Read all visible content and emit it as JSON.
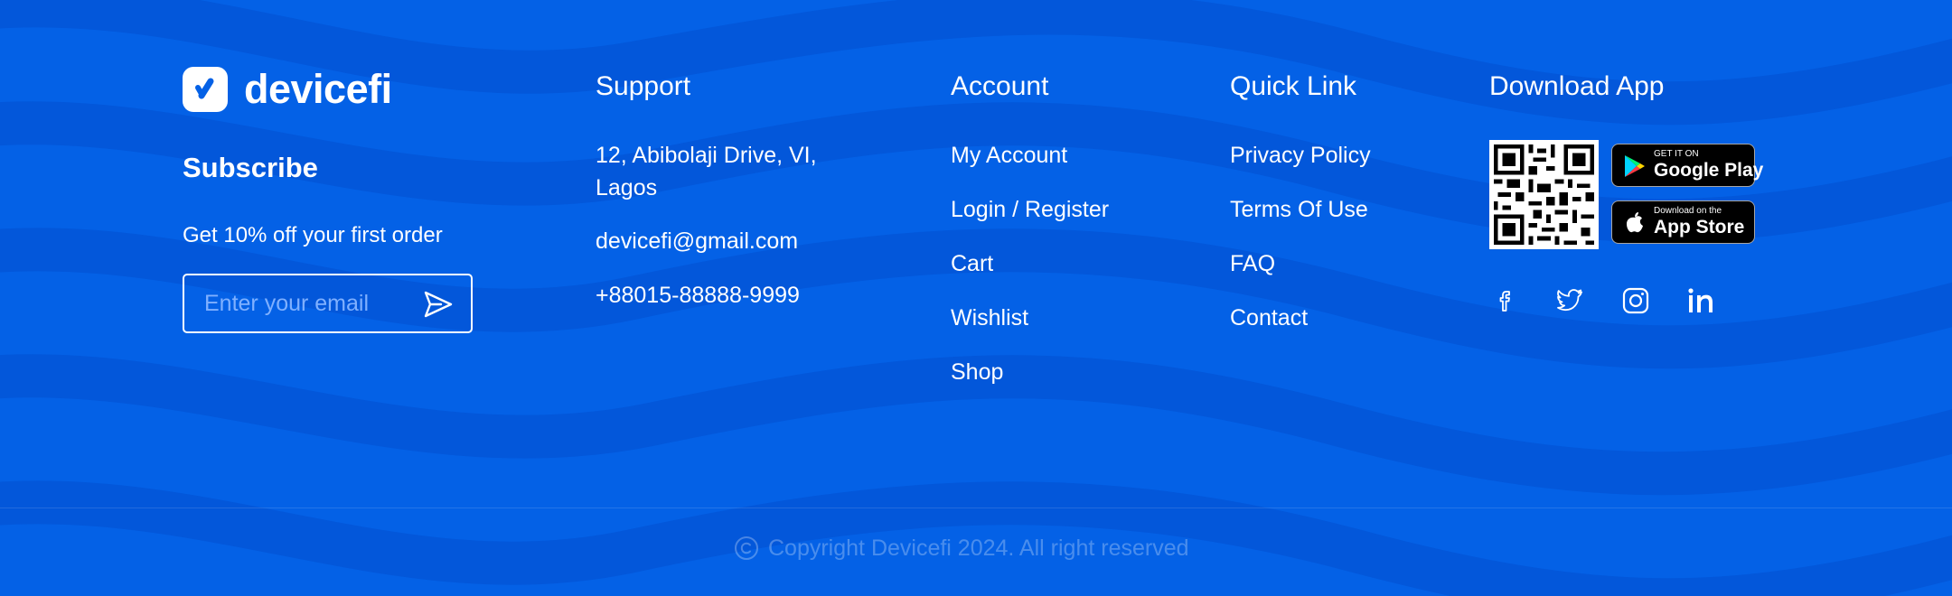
{
  "brand": {
    "name": "devicefi",
    "subscribe_title": "Subscribe",
    "subscribe_text": "Get 10% off your first order",
    "email_placeholder": "Enter your email"
  },
  "support": {
    "heading": "Support",
    "address_line1": "12, Abibolaji Drive, VI,",
    "address_line2": "Lagos",
    "email": "devicefi@gmail.com",
    "phone": "+88015-88888-9999"
  },
  "account": {
    "heading": "Account",
    "links": [
      "My Account",
      "Login / Register",
      "Cart",
      "Wishlist",
      "Shop"
    ]
  },
  "quick_link": {
    "heading": "Quick Link",
    "links": [
      "Privacy Policy",
      "Terms Of Use",
      "FAQ",
      "Contact"
    ]
  },
  "download": {
    "heading": "Download App",
    "google_small": "GET IT ON",
    "google_big": "Google Play",
    "apple_small": "Download on the",
    "apple_big": "App Store"
  },
  "social_icons": [
    "facebook-icon",
    "twitter-icon",
    "instagram-icon",
    "linkedin-icon"
  ],
  "copyright": "Copyright Devicefi 2024. All right reserved",
  "colors": {
    "background": "#0461e6",
    "wave": "#0354d6",
    "text": "#ffffff",
    "placeholder": "#7fb0ff"
  }
}
